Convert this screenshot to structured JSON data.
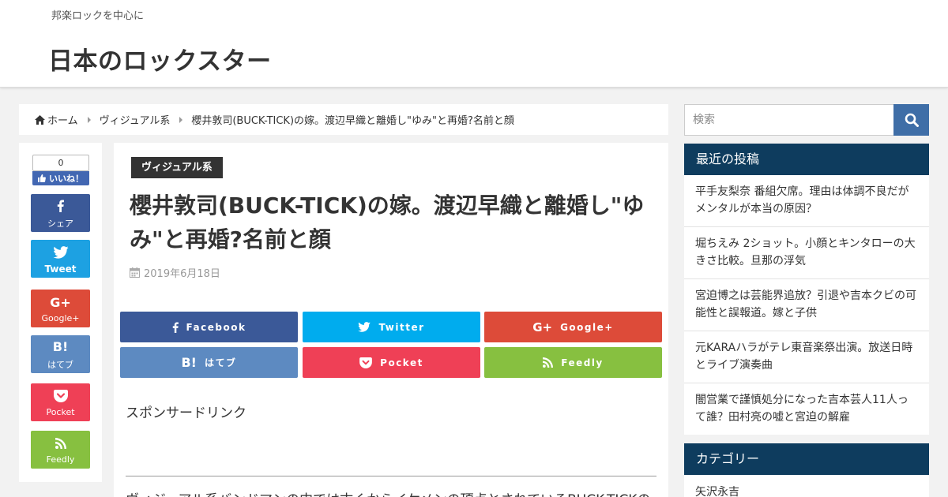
{
  "header": {
    "tagline": "邦楽ロックを中心に",
    "site_title": "日本のロックスター"
  },
  "breadcrumb": {
    "home": "ホーム",
    "category": "ヴィジュアル系",
    "current": "櫻井敦司(BUCK-TICK)の嫁。渡辺早織と離婚し\"ゆみ\"と再婚?名前と顔"
  },
  "share_column": {
    "like_count": "0",
    "like_label": "いいね！",
    "buttons": [
      {
        "label": "シェア",
        "icon": "facebook-icon",
        "color": "#3b5998"
      },
      {
        "label": "Tweet",
        "icon": "twitter-icon",
        "color": "#1da1e2"
      },
      {
        "label": "Google+",
        "icon": "google-plus-icon",
        "color": "#dd4b39"
      },
      {
        "label": "はてブ",
        "icon": "hatena-icon",
        "icon_text": "B!",
        "color": "#5d8ac1"
      },
      {
        "label": "Pocket",
        "icon": "pocket-icon",
        "color": "#ef4056"
      },
      {
        "label": "Feedly",
        "icon": "feedly-icon",
        "color": "#87c040"
      }
    ]
  },
  "article": {
    "category": "ヴィジュアル系",
    "title": "櫻井敦司(BUCK-TICK)の嫁。渡辺早織と離婚し\"ゆみ\"と再婚?名前と顔",
    "date": "2019年6月18日",
    "share_buttons": [
      {
        "label": "Facebook",
        "icon": "facebook-icon",
        "color": "#3b5998"
      },
      {
        "label": "Twitter",
        "icon": "twitter-icon",
        "color": "#00acee"
      },
      {
        "label": "Google+",
        "icon": "google-plus-icon",
        "color": "#dd4b39"
      },
      {
        "label": "はてブ",
        "icon": "hatena-icon",
        "icon_text": "B!",
        "color": "#5d8ac1"
      },
      {
        "label": "Pocket",
        "icon": "pocket-icon",
        "color": "#ef4056"
      },
      {
        "label": "Feedly",
        "icon": "feedly-icon",
        "color": "#87c040"
      }
    ],
    "sponsor_label": "スポンサードリンク",
    "body_first_line": "ヴィジュアル系バンドマンの中では古くからイケメンの頂点とされているBUCK-TICKの"
  },
  "sidebar": {
    "search_placeholder": "検索",
    "recent_title": "最近の投稿",
    "recent_posts": [
      "平手友梨奈 番組欠席。理由は体調不良だがメンタルが本当の原因？",
      "堀ちえみ 2ショット。小顔とキンタローの大きさ比較。旦那の浮気",
      "宮迫博之は芸能界追放？引退や吉本クビの可能性と誤報道。嫁と子供",
      "元KARAハラがテレ東音楽祭出演。放送日時とライブ演奏曲",
      "闇営業で謹慎処分になった吉本芸人11人って誰？田村亮の嘘と宮迫の解雇"
    ],
    "category_title": "カテゴリー",
    "categories": [
      "矢沢永吉"
    ]
  },
  "colors": {
    "header_bg": "#ffffff",
    "page_bg": "#f2f2f2",
    "widget_head": "#0e3c5e",
    "search_btn": "#3f6ea7",
    "category_badge": "#333333"
  }
}
